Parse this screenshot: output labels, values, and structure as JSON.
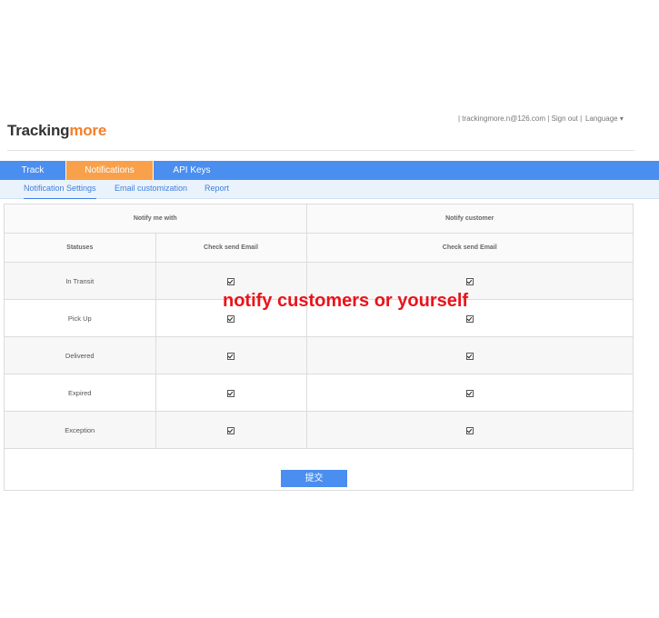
{
  "header": {
    "logo_part1": "Tracking",
    "logo_part2": "more",
    "account_links": "| trackingmore.n@126.com | Sign out |",
    "language": "Language ▾"
  },
  "nav": {
    "tabs": [
      {
        "label": "Track"
      },
      {
        "label": "Notifications",
        "active": true
      },
      {
        "label": "API Keys"
      }
    ]
  },
  "subnav": {
    "items": [
      {
        "label": "Notification Settings",
        "active": true
      },
      {
        "label": "Email customization"
      },
      {
        "label": "Report"
      }
    ]
  },
  "table": {
    "group_headers": {
      "me": "Notify me with",
      "customer": "Notify customer"
    },
    "column_headers": {
      "statuses": "Statuses",
      "me_email": "Check send Email",
      "customer_email": "Check send Email"
    },
    "rows": [
      {
        "status": "In Transit",
        "me_email": true,
        "customer_email": true
      },
      {
        "status": "Pick Up",
        "me_email": true,
        "customer_email": true
      },
      {
        "status": "Delivered",
        "me_email": true,
        "customer_email": true
      },
      {
        "status": "Expired",
        "me_email": true,
        "customer_email": true
      },
      {
        "status": "Exception",
        "me_email": true,
        "customer_email": true
      }
    ]
  },
  "submit_label": "提交",
  "overlay_text": "notify customers or yourself",
  "colors": {
    "nav_blue": "#4a8ef0",
    "active_orange": "#f9a04a",
    "logo_orange": "#f47f2a",
    "overlay_red": "#e8141b"
  }
}
